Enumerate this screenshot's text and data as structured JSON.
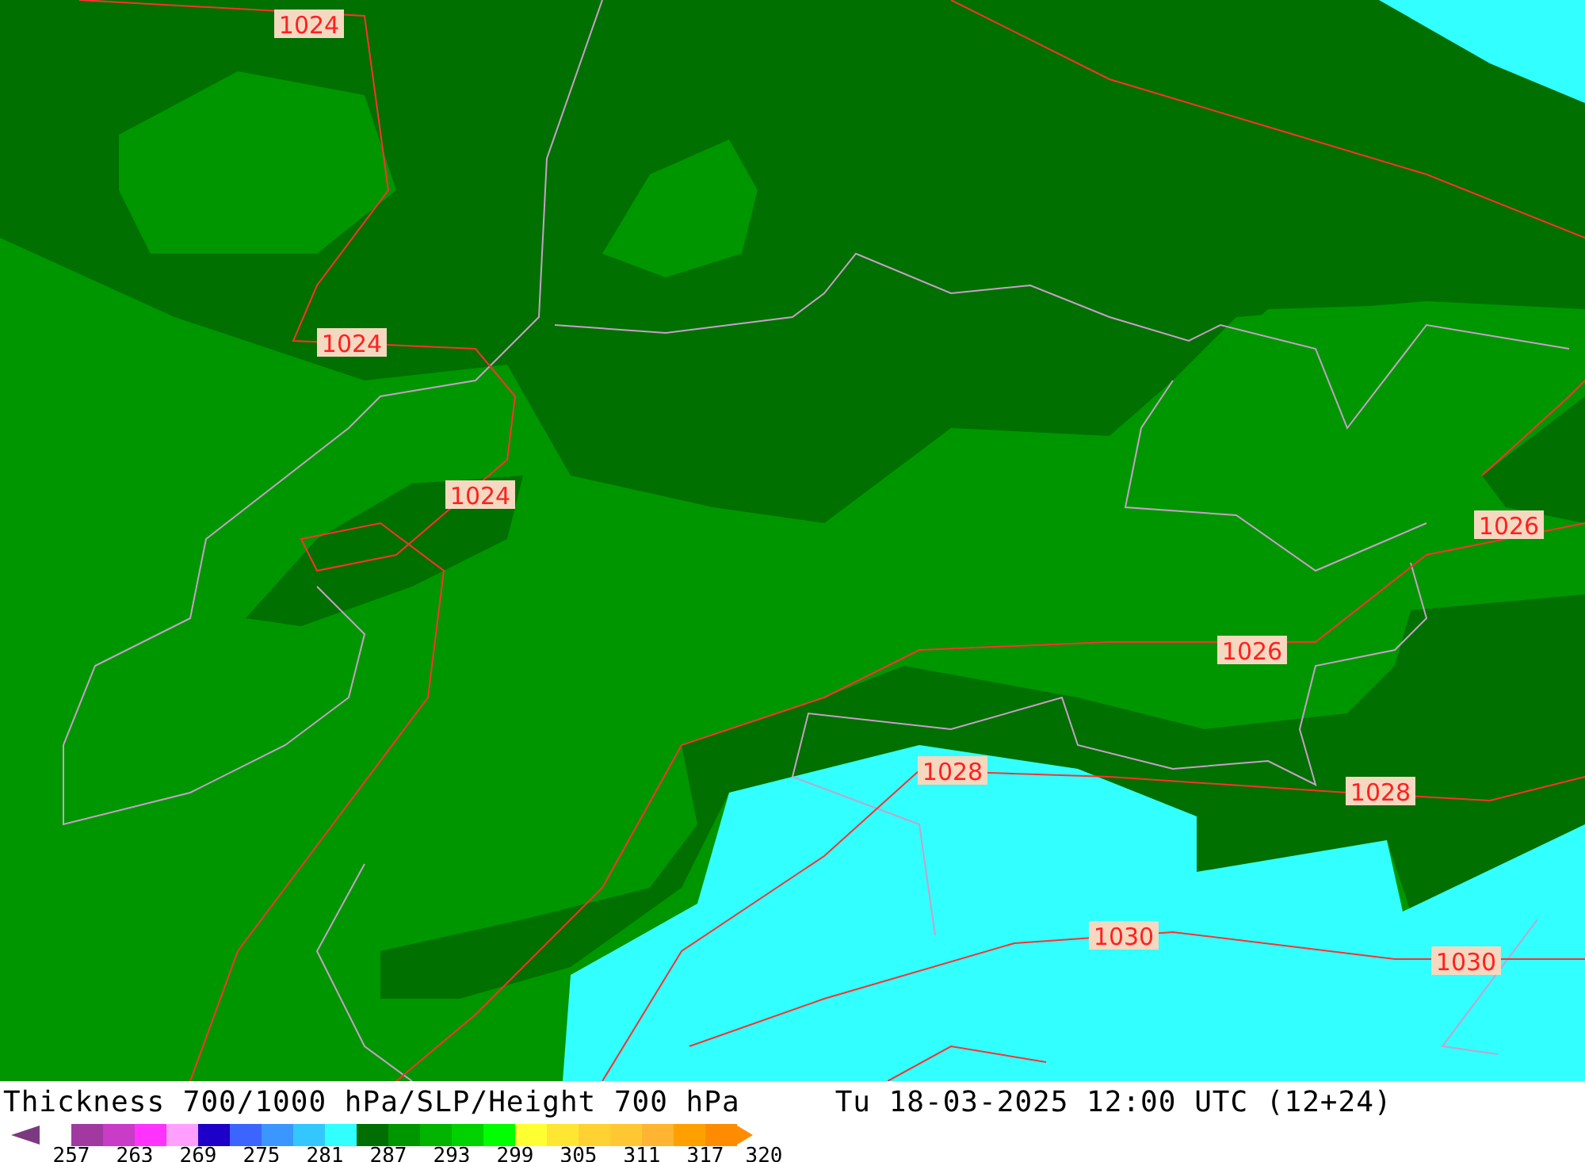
{
  "map": {
    "isobar_labels": [
      "1024",
      "1024",
      "1024",
      "1026",
      "1026",
      "1028",
      "1028",
      "1030",
      "1030"
    ]
  },
  "caption": {
    "title": "Thickness 700/1000 hPa/SLP/Height 700 hPa",
    "valid_time": "Tu 18-03-2025 12:00 UTC (12+24)"
  },
  "legend": {
    "swatches": [
      {
        "kind": "arrow-left",
        "color": "#7b3a7f"
      },
      {
        "color": "#a03aa0"
      },
      {
        "color": "#c83cc8"
      },
      {
        "color": "#ff32ff"
      },
      {
        "color": "#ffa0ff"
      },
      {
        "color": "#1e00c8"
      },
      {
        "color": "#3c64ff"
      },
      {
        "color": "#3c96ff"
      },
      {
        "color": "#32c8ff"
      },
      {
        "color": "#32ffff"
      },
      {
        "color": "#006e00"
      },
      {
        "color": "#009600"
      },
      {
        "color": "#00b400"
      },
      {
        "color": "#00d200"
      },
      {
        "color": "#00ff00"
      },
      {
        "color": "#ffff32"
      },
      {
        "color": "#ffe632"
      },
      {
        "color": "#ffd232"
      },
      {
        "color": "#ffc832"
      },
      {
        "color": "#ffb432"
      },
      {
        "color": "#ffa000"
      },
      {
        "color": "#ff8c00"
      },
      {
        "kind": "arrow-right",
        "color": "#ff8c00"
      }
    ],
    "ticks": [
      "257",
      "263",
      "269",
      "275",
      "281",
      "287",
      "293",
      "299",
      "305",
      "311",
      "317",
      "320"
    ]
  }
}
